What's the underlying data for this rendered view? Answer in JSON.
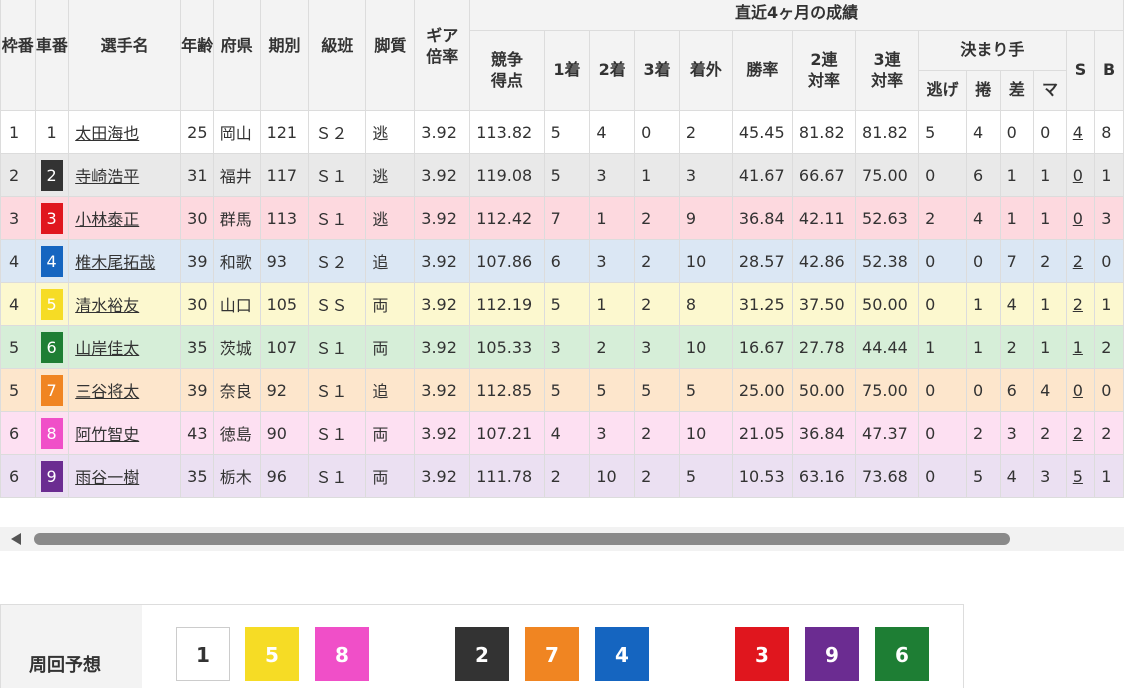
{
  "header": {
    "waku": "枠番",
    "sha": "車番",
    "name": "選手名",
    "age": "年齢",
    "pref": "府県",
    "term": "期別",
    "class": "級班",
    "style": "脚質",
    "gear": "ギア倍率",
    "recent": "直近4ヶ月の成績",
    "score": "競争得点",
    "first": "1着",
    "second": "2着",
    "third": "3着",
    "out": "着外",
    "win": "勝率",
    "ren2": "2連対率",
    "ren3": "3連対率",
    "kimarite": "決まり手",
    "nige": "逃げ",
    "makuri": "捲",
    "sashi": "差",
    "mark": "マ",
    "s": "S",
    "b": "B"
  },
  "racers": [
    {
      "waku": "1",
      "sha": "1",
      "color": "#ffffff",
      "text": "#333333",
      "name": "太田海也",
      "age": "25",
      "pref": "岡山",
      "term": "121",
      "class": "Ｓ２",
      "style": "逃",
      "gear": "3.92",
      "score": "113.82",
      "first": "5",
      "second": "4",
      "third": "0",
      "out": "2",
      "win": "45.45",
      "ren2": "81.82",
      "ren3": "81.82",
      "nige": "5",
      "makuri": "4",
      "sashi": "0",
      "mark": "0",
      "s": "4",
      "b": "8",
      "row_bg": "#ffffff"
    },
    {
      "waku": "2",
      "sha": "2",
      "color": "#333333",
      "text": "#ffffff",
      "name": "寺崎浩平",
      "age": "31",
      "pref": "福井",
      "term": "117",
      "class": "Ｓ１",
      "style": "逃",
      "gear": "3.92",
      "score": "119.08",
      "first": "5",
      "second": "3",
      "third": "1",
      "out": "3",
      "win": "41.67",
      "ren2": "66.67",
      "ren3": "75.00",
      "nige": "0",
      "makuri": "6",
      "sashi": "1",
      "mark": "1",
      "s": "0",
      "b": "1",
      "row_bg": "#e9e9e9"
    },
    {
      "waku": "3",
      "sha": "3",
      "color": "#e0161e",
      "text": "#ffffff",
      "name": "小林泰正",
      "age": "30",
      "pref": "群馬",
      "term": "113",
      "class": "Ｓ１",
      "style": "逃",
      "gear": "3.92",
      "score": "112.42",
      "first": "7",
      "second": "1",
      "third": "2",
      "out": "9",
      "win": "36.84",
      "ren2": "42.11",
      "ren3": "52.63",
      "nige": "2",
      "makuri": "4",
      "sashi": "1",
      "mark": "1",
      "s": "0",
      "b": "3",
      "row_bg": "#fdd9df"
    },
    {
      "waku": "4",
      "sha": "4",
      "color": "#1565c0",
      "text": "#ffffff",
      "name": "椎木尾拓哉",
      "age": "39",
      "pref": "和歌",
      "term": "93",
      "class": "Ｓ２",
      "style": "追",
      "gear": "3.92",
      "score": "107.86",
      "first": "6",
      "second": "3",
      "third": "2",
      "out": "10",
      "win": "28.57",
      "ren2": "42.86",
      "ren3": "52.38",
      "nige": "0",
      "makuri": "0",
      "sashi": "7",
      "mark": "2",
      "s": "2",
      "b": "0",
      "row_bg": "#dbe7f4"
    },
    {
      "waku": "4",
      "sha": "5",
      "color": "#f6dc25",
      "text": "#ffffff",
      "name": "清水裕友",
      "age": "30",
      "pref": "山口",
      "term": "105",
      "class": "ＳＳ",
      "style": "両",
      "gear": "3.92",
      "score": "112.19",
      "first": "5",
      "second": "1",
      "third": "2",
      "out": "8",
      "win": "31.25",
      "ren2": "37.50",
      "ren3": "50.00",
      "nige": "0",
      "makuri": "1",
      "sashi": "4",
      "mark": "1",
      "s": "2",
      "b": "1",
      "row_bg": "#fcf8cf"
    },
    {
      "waku": "5",
      "sha": "6",
      "color": "#1e7e34",
      "text": "#ffffff",
      "name": "山岸佳太",
      "age": "35",
      "pref": "茨城",
      "term": "107",
      "class": "Ｓ１",
      "style": "両",
      "gear": "3.92",
      "score": "105.33",
      "first": "3",
      "second": "2",
      "third": "3",
      "out": "10",
      "win": "16.67",
      "ren2": "27.78",
      "ren3": "44.44",
      "nige": "1",
      "makuri": "1",
      "sashi": "2",
      "mark": "1",
      "s": "1",
      "b": "2",
      "row_bg": "#d6eed8"
    },
    {
      "waku": "5",
      "sha": "7",
      "color": "#f08522",
      "text": "#ffffff",
      "name": "三谷将太",
      "age": "39",
      "pref": "奈良",
      "term": "92",
      "class": "Ｓ１",
      "style": "追",
      "gear": "3.92",
      "score": "112.85",
      "first": "5",
      "second": "5",
      "third": "5",
      "out": "5",
      "win": "25.00",
      "ren2": "50.00",
      "ren3": "75.00",
      "nige": "0",
      "makuri": "0",
      "sashi": "6",
      "mark": "4",
      "s": "0",
      "b": "0",
      "row_bg": "#fde6cc"
    },
    {
      "waku": "6",
      "sha": "8",
      "color": "#f04fc8",
      "text": "#ffffff",
      "name": "阿竹智史",
      "age": "43",
      "pref": "徳島",
      "term": "90",
      "class": "Ｓ１",
      "style": "両",
      "gear": "3.92",
      "score": "107.21",
      "first": "4",
      "second": "3",
      "third": "2",
      "out": "10",
      "win": "21.05",
      "ren2": "36.84",
      "ren3": "47.37",
      "nige": "0",
      "makuri": "2",
      "sashi": "3",
      "mark": "2",
      "s": "2",
      "b": "2",
      "row_bg": "#fde0f2"
    },
    {
      "waku": "6",
      "sha": "9",
      "color": "#6b2c91",
      "text": "#ffffff",
      "name": "雨谷一樹",
      "age": "35",
      "pref": "栃木",
      "term": "96",
      "class": "Ｓ１",
      "style": "両",
      "gear": "3.92",
      "score": "111.78",
      "first": "2",
      "second": "10",
      "third": "2",
      "out": "5",
      "win": "10.53",
      "ren2": "63.16",
      "ren3": "73.68",
      "nige": "0",
      "makuri": "5",
      "sashi": "4",
      "mark": "3",
      "s": "5",
      "b": "1",
      "row_bg": "#ebe0f2"
    }
  ],
  "prediction": {
    "label": "周回予想",
    "chips": [
      {
        "num": "1",
        "bg": "#ffffff",
        "fg": "#333333",
        "border": "#cccccc"
      },
      {
        "num": "5",
        "bg": "#f6dc25",
        "fg": "#ffffff",
        "border": "#f6dc25"
      },
      {
        "num": "8",
        "bg": "#f04fc8",
        "fg": "#ffffff",
        "border": "#f04fc8"
      },
      {
        "num": "2",
        "bg": "#333333",
        "fg": "#ffffff",
        "border": "#333333"
      },
      {
        "num": "7",
        "bg": "#f08522",
        "fg": "#ffffff",
        "border": "#f08522"
      },
      {
        "num": "4",
        "bg": "#1565c0",
        "fg": "#ffffff",
        "border": "#1565c0"
      },
      {
        "num": "3",
        "bg": "#e0161e",
        "fg": "#ffffff",
        "border": "#e0161e"
      },
      {
        "num": "9",
        "bg": "#6b2c91",
        "fg": "#ffffff",
        "border": "#6b2c91"
      },
      {
        "num": "6",
        "bg": "#1e7e34",
        "fg": "#ffffff",
        "border": "#1e7e34"
      }
    ]
  }
}
